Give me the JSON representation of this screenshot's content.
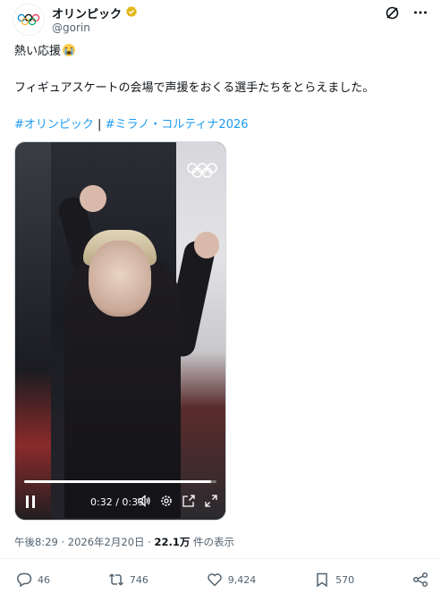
{
  "author": {
    "display_name": "オリンピック",
    "handle": "@gorin",
    "verified_color": "#e2b719"
  },
  "post": {
    "line1": "熱い応援",
    "line2": "フィギュアスケートの会場で声援をおくる選手たちをとらえました。",
    "hashtags": [
      "#オリンピック",
      "#ミラノ・コルティナ2026"
    ],
    "separator": "|"
  },
  "video": {
    "time": "0:32 / 0:33",
    "progress": 0.97
  },
  "meta": {
    "timestamp": "午後8:29 · 2026年2月20日 · ",
    "views": "22.1万",
    "views_suffix": " 件の表示"
  },
  "actions": {
    "replies": "46",
    "reposts": "746",
    "likes": "9,424",
    "bookmarks": "570"
  },
  "colors": {
    "accent": "#1d9bf0",
    "text": "#0f1419",
    "secondary": "#536471"
  }
}
